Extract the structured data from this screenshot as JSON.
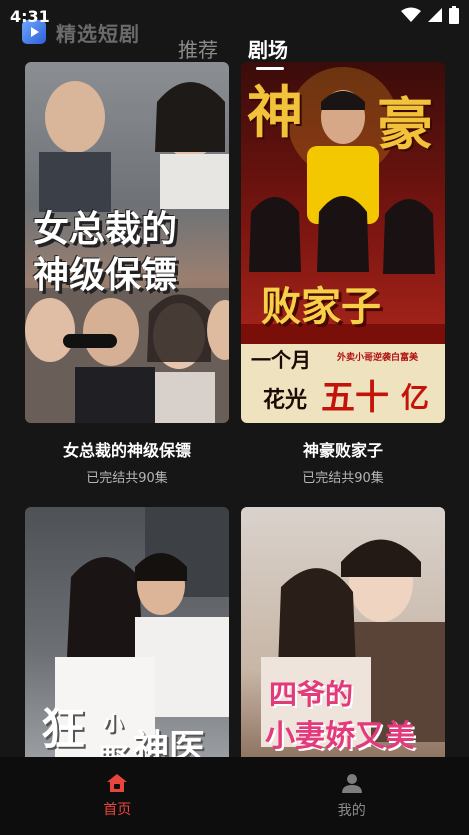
{
  "status_bar": {
    "time": "4:31"
  },
  "header": {
    "app_title": "精选短剧"
  },
  "tabs": [
    {
      "label": "推荐"
    },
    {
      "label": "剧场"
    }
  ],
  "dramas": [
    {
      "title": "女总裁的神级保镖",
      "status": "已完结共90集",
      "poster_text": [
        "女总裁的",
        "神级保镖"
      ]
    },
    {
      "title": "神豪败家子",
      "status": "已完结共90集",
      "poster_text": [
        "神",
        "豪",
        "败家子",
        "一个月",
        "外卖小哥逆袭白富美",
        "花光",
        "五十",
        "亿"
      ]
    },
    {
      "title": "",
      "status": "",
      "poster_text": [
        "狂",
        "小",
        "神医",
        "野"
      ]
    },
    {
      "title": "",
      "status": "",
      "poster_text": [
        "四爷的",
        "小妻娇又美"
      ]
    }
  ],
  "bottom_nav": [
    {
      "label": "首页",
      "icon": "home-icon",
      "active": true
    },
    {
      "label": "我的",
      "icon": "user-icon",
      "active": false
    }
  ],
  "colors": {
    "accent": "#e8453c",
    "background": "#161616"
  }
}
